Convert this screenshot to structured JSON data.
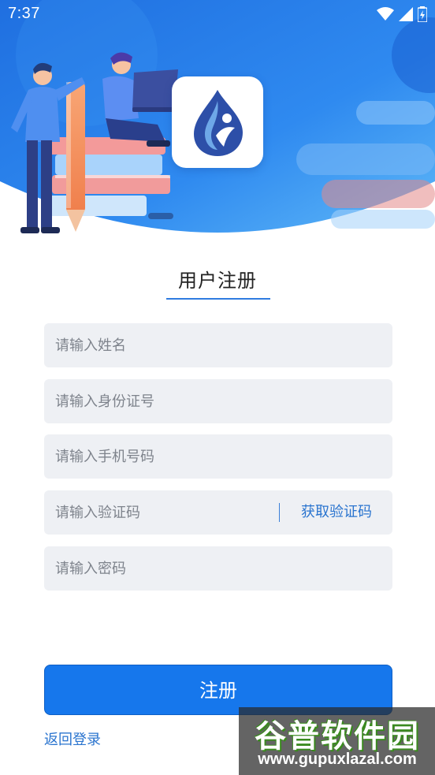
{
  "status_bar": {
    "time": "7:37",
    "icons": [
      "wifi-icon",
      "signal-icon",
      "battery-icon"
    ]
  },
  "header": {
    "logo": "app-logo"
  },
  "form": {
    "title": "用户注册",
    "name_placeholder": "请输入姓名",
    "id_placeholder": "请输入身份证号",
    "phone_placeholder": "请输入手机号码",
    "code_placeholder": "请输入验证码",
    "get_code_label": "获取验证码",
    "password_placeholder": "请输入密码",
    "submit_label": "注册",
    "back_login_label": "返回登录"
  },
  "watermark": {
    "title": "谷普软件园",
    "url": "www.gupuxlazal.com"
  },
  "colors": {
    "primary": "#1677ec",
    "link": "#2a74cf",
    "field_bg": "#eef0f4",
    "header_gradient_start": "#1f6fe0",
    "header_gradient_end": "#5fb8f7"
  }
}
